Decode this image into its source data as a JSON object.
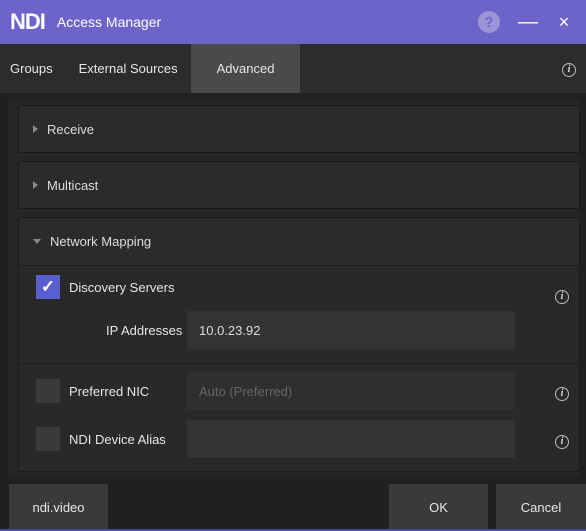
{
  "window": {
    "logo": "NDI",
    "title": "Access Manager",
    "help_glyph": "?",
    "minimize_glyph": "—",
    "close_glyph": "×"
  },
  "tabs": [
    {
      "label": "Groups",
      "active": false
    },
    {
      "label": "External Sources",
      "active": false
    },
    {
      "label": "Advanced",
      "active": true
    }
  ],
  "info_glyph": "i",
  "sections": {
    "receive": {
      "label": "Receive",
      "expanded": false
    },
    "multicast": {
      "label": "Multicast",
      "expanded": false
    },
    "network_mapping": {
      "label": "Network Mapping",
      "expanded": true
    }
  },
  "network_mapping": {
    "discovery_servers": {
      "label": "Discovery Servers",
      "checked": true,
      "check_glyph": "✓"
    },
    "ip_addresses": {
      "label": "IP Addresses",
      "value": "10.0.23.92"
    },
    "preferred_nic": {
      "label": "Preferred NIC",
      "checked": false,
      "value": "Auto (Preferred)"
    },
    "device_alias": {
      "label": "NDI Device Alias",
      "checked": false,
      "value": ""
    }
  },
  "footer": {
    "link_label": "ndi.video",
    "ok_label": "OK",
    "cancel_label": "Cancel"
  },
  "colors": {
    "titlebar": "#6d64c9",
    "checkbox_checked": "#5a5fcf"
  },
  "icons": [
    "help-icon",
    "minimize-icon",
    "close-icon",
    "info-icon",
    "chevron-right-icon",
    "chevron-down-icon",
    "check-icon"
  ]
}
